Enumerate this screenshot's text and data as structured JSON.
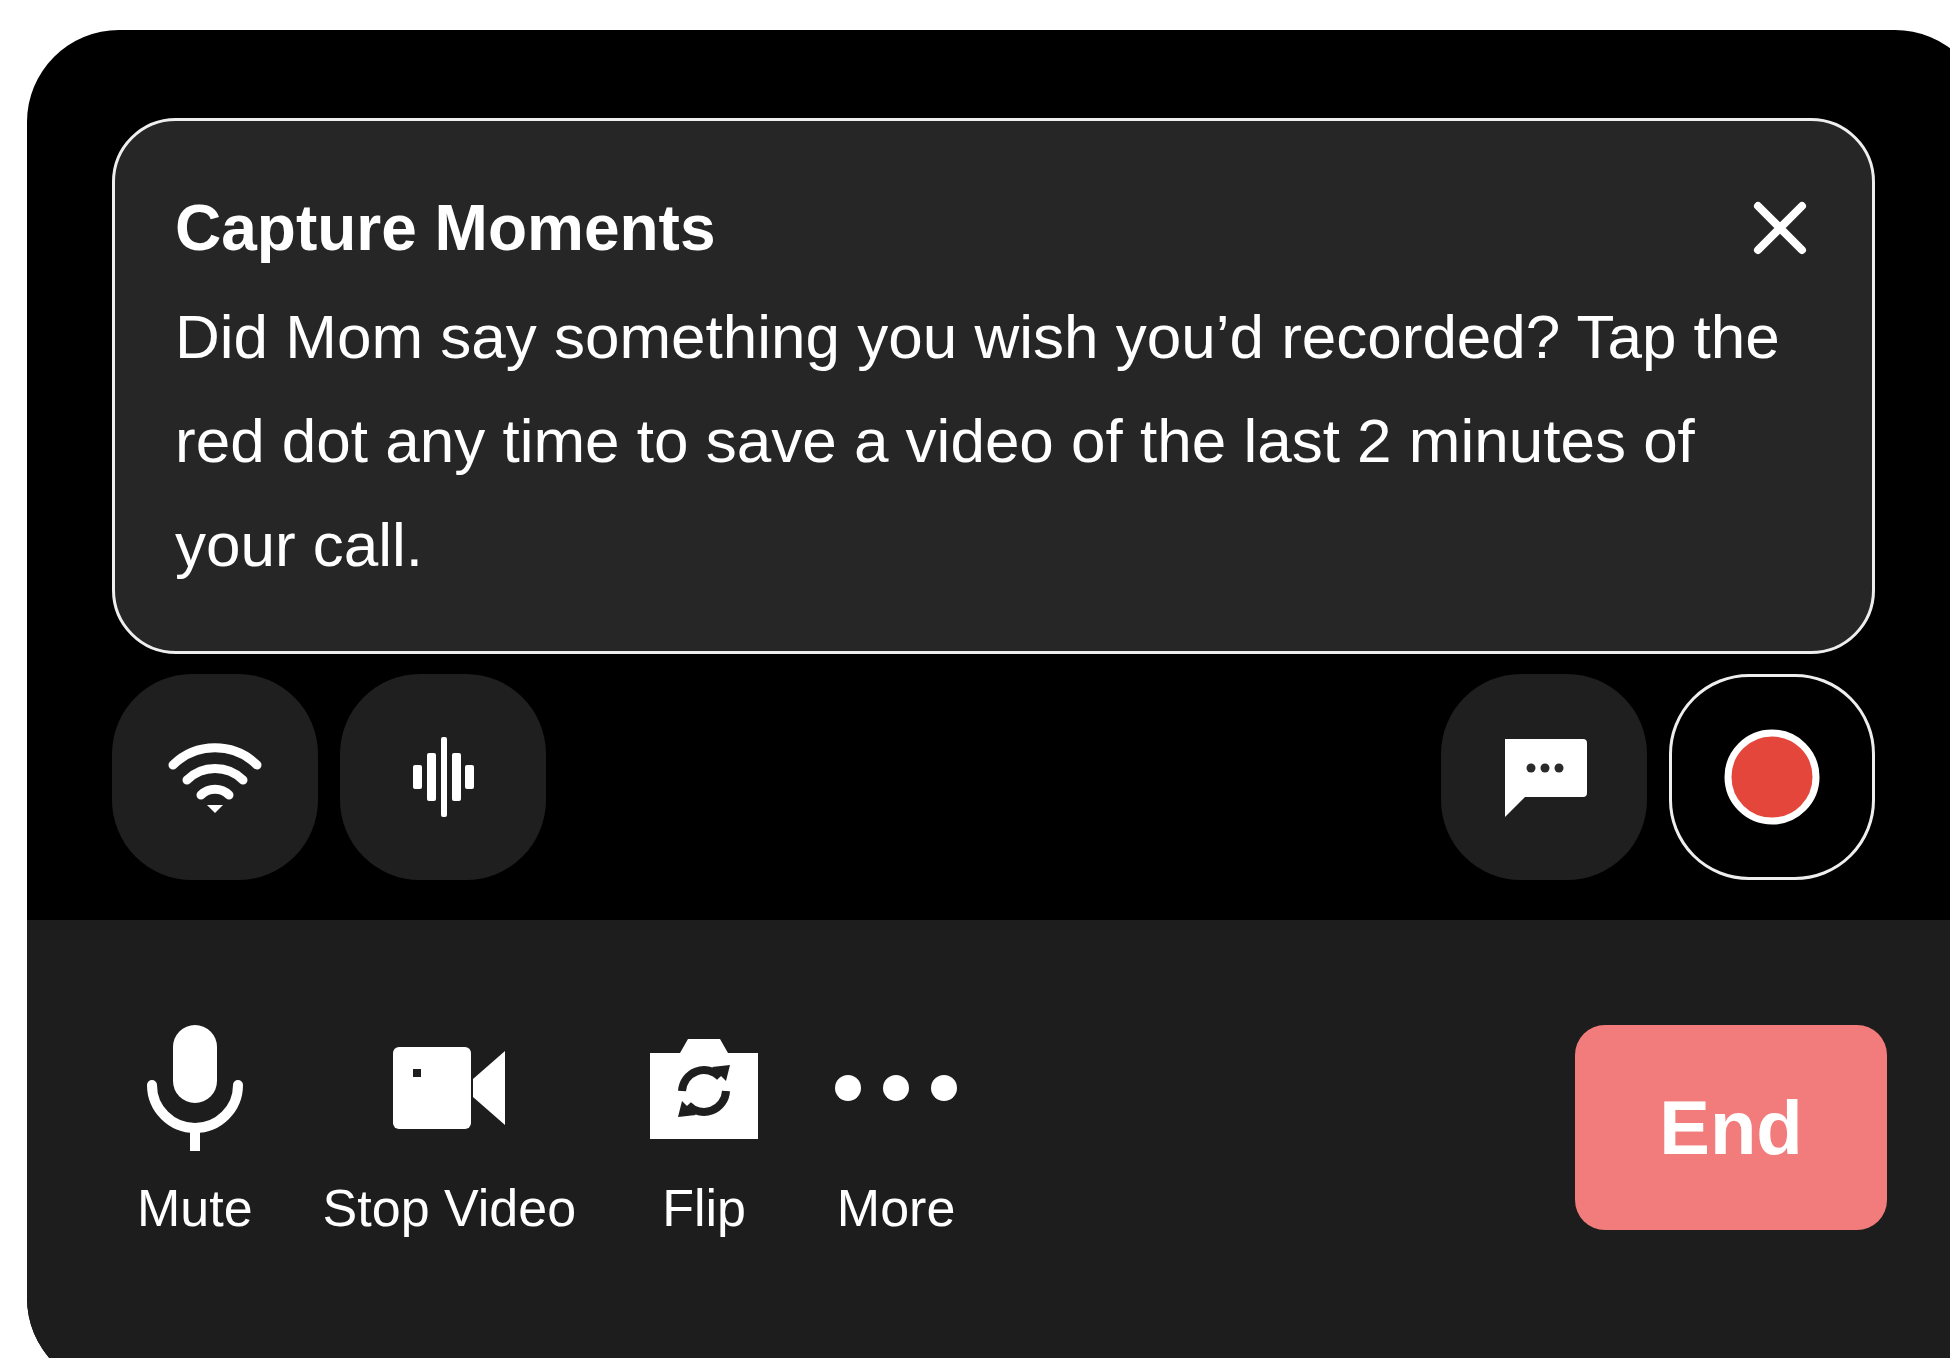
{
  "tip": {
    "title": "Capture Moments",
    "body": "Did Mom say something you wish you’d recorded? Tap the red dot any time to save a video of the last 2 minutes of your call."
  },
  "status_buttons": [
    {
      "kind": "wifi"
    },
    {
      "kind": "audio"
    }
  ],
  "side_buttons": [
    {
      "kind": "chat"
    },
    {
      "kind": "record"
    }
  ],
  "toolbar": [
    {
      "label": "Mute",
      "kind": "mic"
    },
    {
      "label": "Stop Video",
      "kind": "video"
    },
    {
      "label": "Flip",
      "kind": "flip"
    },
    {
      "label": "More",
      "kind": "more"
    }
  ],
  "end_button": {
    "label": "End"
  }
}
